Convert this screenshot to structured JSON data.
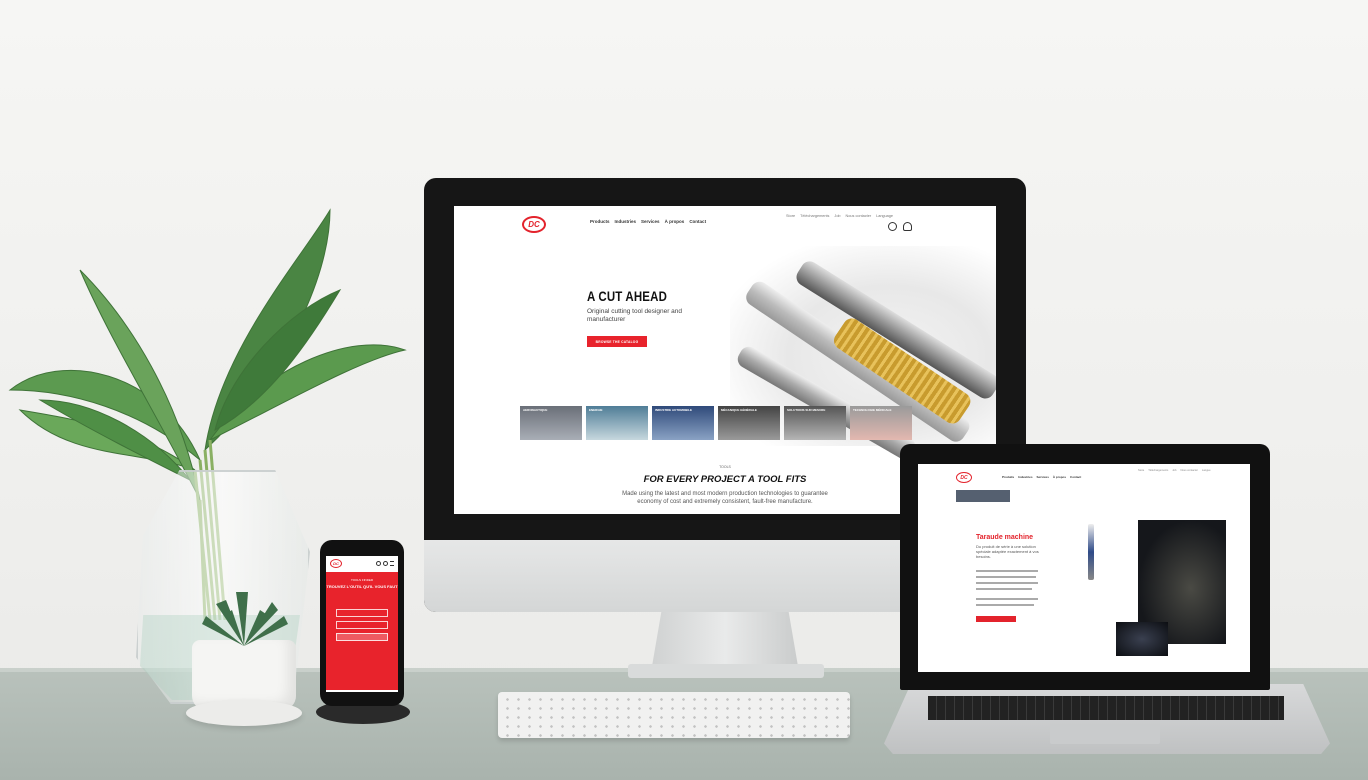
{
  "colors": {
    "brand_red": "#e3232c",
    "wall": "#f4f4f2",
    "desk": "#b4bdb7"
  },
  "imac": {
    "logo": "DC",
    "nav_menu": [
      "Products",
      "Industries",
      "Services",
      "À propos",
      "Contact"
    ],
    "nav_top": [
      "Store",
      "Téléchargements",
      "Job",
      "Nous contacter",
      "Language"
    ],
    "header_icons": [
      "search-icon",
      "user-icon"
    ],
    "hero": {
      "title": "A CUT AHEAD",
      "subtitle": "Original cutting tool designer and manufacturer",
      "button": "BROWSE THE CATALOG"
    },
    "tiles": [
      "AERONAUTIQUE",
      "ENERGIE",
      "INDUSTRIE AUTOMOBILE",
      "MÉCANIQUE GÉNÉRALE",
      "SOLUTIONS SUR MESURE",
      "TECHNOLOGIE MÉDICALE"
    ],
    "section": {
      "label": "TOOLS",
      "title": "FOR EVERY PROJECT A TOOL FITS",
      "text": "Made using the latest and most modern production technologies to guarantee economy of cost and extremely consistent, fault-free manufacture."
    }
  },
  "laptop": {
    "logo": "DC",
    "nav_menu": [
      "Produits",
      "Industries",
      "Services",
      "À propos",
      "Contact"
    ],
    "nav_top": [
      "Store",
      "Téléchargements",
      "Job",
      "Nous contacter",
      "Langue"
    ],
    "product_title": "Taraude machine",
    "product_subtitle": "Du produit de série à une solution spéciale adaptée exactement à vos besoins."
  },
  "phone": {
    "logo": "DC",
    "heading_small": "TOOLS FINDER",
    "heading": "TROUVEZ L'OUTIL QU'IL VOUS FAUT"
  }
}
